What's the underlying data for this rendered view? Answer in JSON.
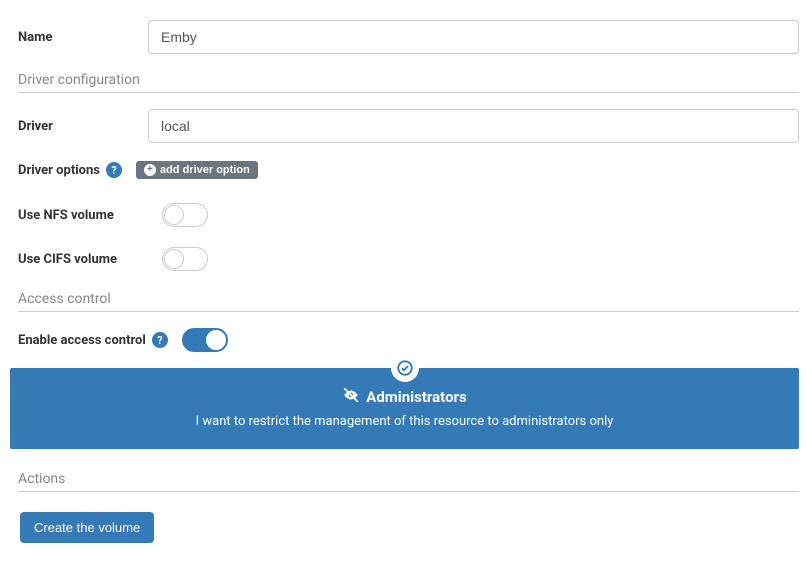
{
  "name": {
    "label": "Name",
    "value": "Emby"
  },
  "driverSection": {
    "header": "Driver configuration"
  },
  "driver": {
    "label": "Driver",
    "value": "local"
  },
  "driverOptions": {
    "label": "Driver options",
    "addBtn": "add driver option"
  },
  "nfs": {
    "label": "Use NFS volume",
    "on": false
  },
  "cifs": {
    "label": "Use CIFS volume",
    "on": false
  },
  "accessSection": {
    "header": "Access control"
  },
  "accessControl": {
    "label": "Enable access control",
    "on": true
  },
  "adminCard": {
    "title": "Administrators",
    "desc": "I want to restrict the management of this resource to administrators only"
  },
  "actionsSection": {
    "header": "Actions"
  },
  "createBtn": "Create the volume"
}
